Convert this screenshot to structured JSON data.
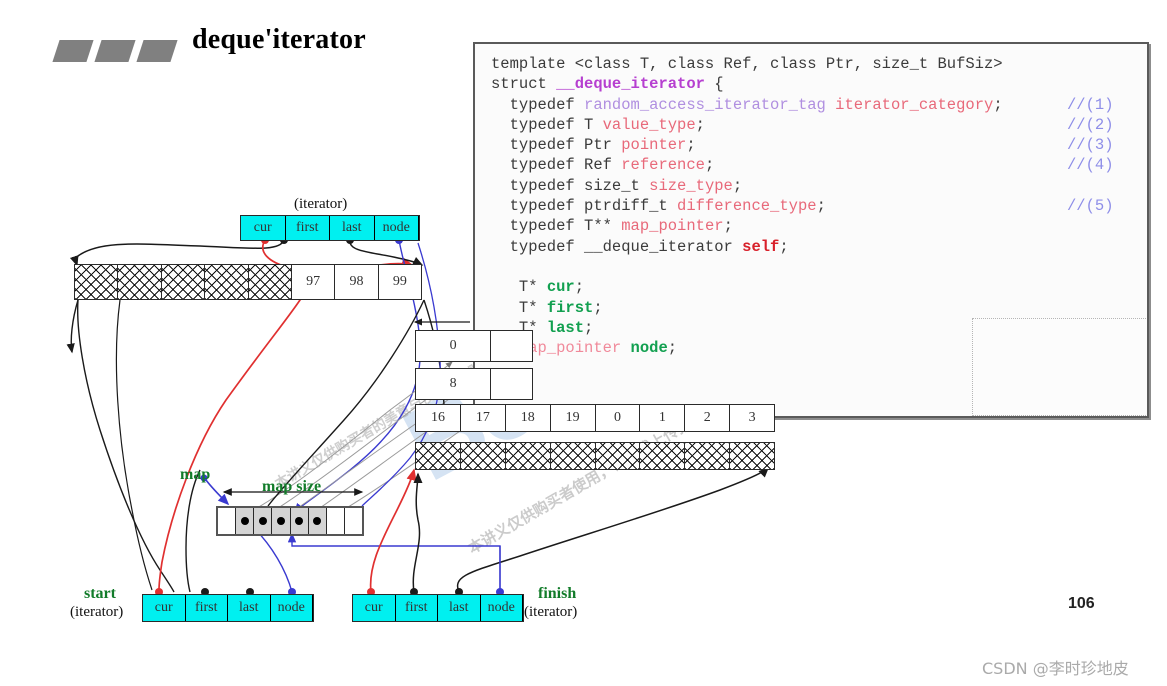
{
  "slide": {
    "title": "deque'iterator",
    "page_number": "106",
    "watermark_main": "博览网",
    "watermark_blue": "Bolan",
    "watermark_note": "本讲义仅供购买者使用，请勿线上传播，伤害侵老师与课与财权。",
    "watermark_note2": "本讲义仅供购买者的美意与侵老师与财权。",
    "csdn_credit": "CSDN @李时珍地皮"
  },
  "code": {
    "lines": [
      {
        "segments": [
          {
            "t": "template <class T, class Ref, class Ptr, size_t BufSiz>",
            "c": "kw"
          }
        ],
        "comment": ""
      },
      {
        "segments": [
          {
            "t": "struct ",
            "c": "kw"
          },
          {
            "t": "__deque_iterator",
            "c": "purple-b"
          },
          {
            "t": " {",
            "c": "kw"
          }
        ],
        "comment": ""
      },
      {
        "segments": [
          {
            "t": "  typedef ",
            "c": "kw"
          },
          {
            "t": "random_access_iterator_tag",
            "c": "tpl"
          },
          {
            "t": " ",
            "c": "kw"
          },
          {
            "t": "iterator_category",
            "c": "tname"
          },
          {
            "t": ";",
            "c": "kw"
          }
        ],
        "comment": "//(1)"
      },
      {
        "segments": [
          {
            "t": "  typedef T ",
            "c": "kw"
          },
          {
            "t": "value_type",
            "c": "tname"
          },
          {
            "t": ";",
            "c": "kw"
          }
        ],
        "comment": "//(2)"
      },
      {
        "segments": [
          {
            "t": "  typedef Ptr ",
            "c": "kw"
          },
          {
            "t": "pointer",
            "c": "tname"
          },
          {
            "t": ";",
            "c": "kw"
          }
        ],
        "comment": "//(3)"
      },
      {
        "segments": [
          {
            "t": "  typedef Ref ",
            "c": "kw"
          },
          {
            "t": "reference",
            "c": "tname"
          },
          {
            "t": ";",
            "c": "kw"
          }
        ],
        "comment": "//(4)"
      },
      {
        "segments": [
          {
            "t": "  typedef size_t ",
            "c": "kw"
          },
          {
            "t": "size_type",
            "c": "tname"
          },
          {
            "t": ";",
            "c": "kw"
          }
        ],
        "comment": ""
      },
      {
        "segments": [
          {
            "t": "  typedef ptrdiff_t ",
            "c": "kw"
          },
          {
            "t": "difference_type",
            "c": "tname"
          },
          {
            "t": ";",
            "c": "kw"
          }
        ],
        "comment": "//(5)"
      },
      {
        "segments": [
          {
            "t": "  typedef T** ",
            "c": "kw"
          },
          {
            "t": "map_pointer",
            "c": "tname"
          },
          {
            "t": ";",
            "c": "kw"
          }
        ],
        "comment": ""
      },
      {
        "segments": [
          {
            "t": "  typedef __deque_iterator ",
            "c": "kw"
          },
          {
            "t": "self",
            "c": "red-b"
          },
          {
            "t": ";",
            "c": "kw"
          }
        ],
        "comment": ""
      },
      {
        "segments": [
          {
            "t": "",
            "c": "kw"
          }
        ],
        "comment": ""
      },
      {
        "segments": [
          {
            "t": "   T* ",
            "c": "kw"
          },
          {
            "t": "cur",
            "c": "green-b"
          },
          {
            "t": ";",
            "c": "kw"
          }
        ],
        "comment": ""
      },
      {
        "segments": [
          {
            "t": "   T* ",
            "c": "kw"
          },
          {
            "t": "first",
            "c": "green-b"
          },
          {
            "t": ";",
            "c": "kw"
          }
        ],
        "comment": ""
      },
      {
        "segments": [
          {
            "t": "   T* ",
            "c": "kw"
          },
          {
            "t": "last",
            "c": "green-b"
          },
          {
            "t": ";",
            "c": "kw"
          }
        ],
        "comment": ""
      },
      {
        "segments": [
          {
            "t": "   ",
            "c": "kw"
          },
          {
            "t": "map_pointer",
            "c": "pink"
          },
          {
            "t": " ",
            "c": "kw"
          },
          {
            "t": "node",
            "c": "green-b"
          },
          {
            "t": ";",
            "c": "kw"
          }
        ],
        "comment": ""
      },
      {
        "segments": [
          {
            "t": " ...",
            "c": "kw"
          }
        ],
        "comment": ""
      },
      {
        "segments": [
          {
            "t": " };",
            "c": "kw"
          }
        ],
        "comment": ""
      }
    ]
  },
  "diagram": {
    "iterator_caption_top": "(iterator)",
    "iterator_fields": [
      "cur",
      "first",
      "last",
      "node"
    ],
    "top_buffer": {
      "hatched_count": 5,
      "values": [
        "97",
        "98",
        "99"
      ]
    },
    "index_boxes": [
      "0",
      "8"
    ],
    "index_row": [
      "16",
      "17",
      "18",
      "19",
      "0",
      "1",
      "2",
      "3"
    ],
    "bottom_buffer_cells": 8,
    "map_label": "map",
    "map_size_label": "map  size",
    "map_cells": [
      {
        "filled": false
      },
      {
        "filled": true
      },
      {
        "filled": true
      },
      {
        "filled": true
      },
      {
        "filled": true
      },
      {
        "filled": true
      },
      {
        "filled": false
      },
      {
        "filled": false
      }
    ],
    "start_label": "start",
    "start_caption": "(iterator)",
    "finish_label": "finish",
    "finish_caption": "(iterator)",
    "start_fields": [
      "cur",
      "first",
      "last",
      "node"
    ],
    "finish_fields": [
      "cur",
      "first",
      "last",
      "node"
    ]
  },
  "colors": {
    "iterator_fill": "#00f0f0",
    "label_green": "#127c2a",
    "pointer_red": "#e03030",
    "pointer_blue": "#3a3ad0",
    "pointer_black": "#1a1a1a",
    "map_cell_fill": "#d4d4d4",
    "title_block": "#808080"
  }
}
